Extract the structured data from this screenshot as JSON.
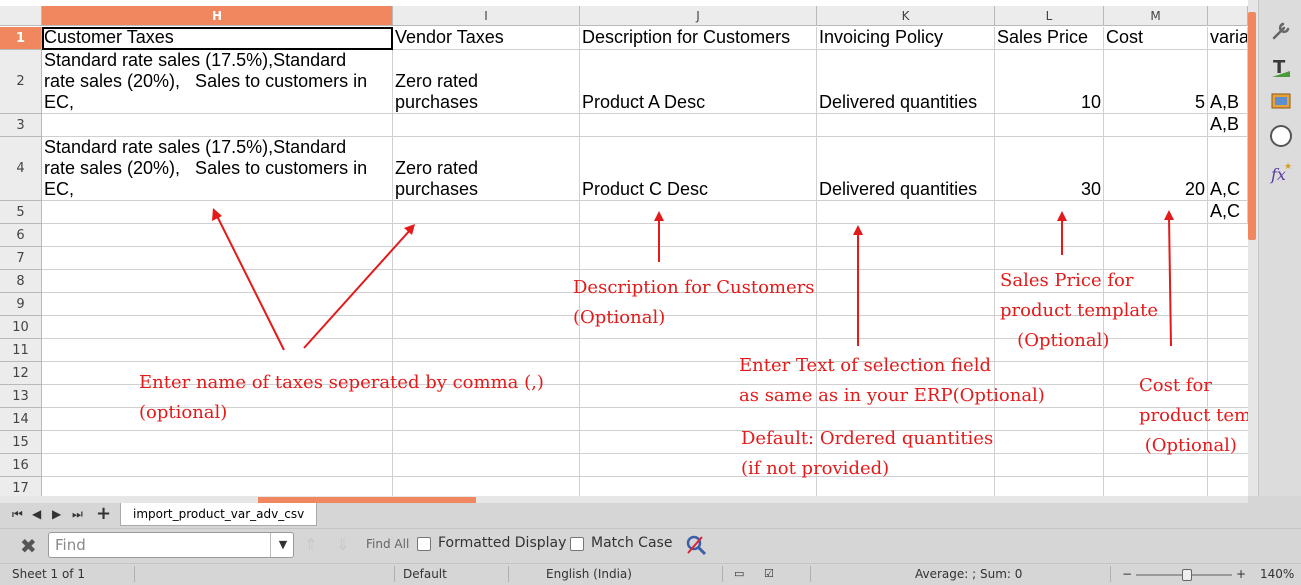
{
  "columns": [
    "H",
    "I",
    "J",
    "K",
    "L",
    "M"
  ],
  "rows": [
    "1",
    "2",
    "3",
    "4",
    "5",
    "6",
    "7",
    "8",
    "9",
    "10",
    "11",
    "12",
    "13",
    "14",
    "15",
    "16",
    "17"
  ],
  "header_row": {
    "h": "Customer Taxes",
    "i": "Vendor Taxes",
    "j": "Description for Customers",
    "k": "Invoicing Policy",
    "l": "Sales Price",
    "m": "Cost",
    "n": "varia"
  },
  "row2": {
    "h": "Standard rate sales (17.5%),Standard\nrate sales (20%),   Sales to customers in\nEC,",
    "i": "Zero rated\npurchases",
    "j": "Product A Desc",
    "k": "Delivered quantities",
    "l": "10",
    "m": "5",
    "n": "A,B"
  },
  "row3": {
    "n": "A,B"
  },
  "row4": {
    "h": "Standard rate sales (17.5%),Standard\nrate sales (20%),   Sales to customers in\nEC,",
    "i": "Zero rated\npurchases",
    "j": "Product C Desc",
    "k": "Delivered quantities",
    "l": "30",
    "m": "20",
    "n": "A,C"
  },
  "row5": {
    "n": "A,C"
  },
  "annotations": {
    "taxes": "Enter name of taxes seperated by comma (,)\n(optional)",
    "description": "Description for Customers\n(Optional)",
    "selection": "Enter Text of selection field\nas same as in your ERP(Optional)",
    "default": "Default: Ordered quantities\n(if not provided)",
    "sales_price": "Sales Price for\nproduct template\n   (Optional)",
    "cost": "Cost for\nproduct template\n (Optional)"
  },
  "sheet_tab": "import_product_var_adv_csv",
  "find": {
    "placeholder": "Find",
    "find_all": "Find All",
    "formatted_display": "Formatted Display",
    "match_case": "Match Case"
  },
  "status": {
    "sheet": "Sheet 1 of 1",
    "style": "Default",
    "language": "English (India)",
    "summary": "Average: ; Sum: 0",
    "zoom": "140%"
  },
  "icons": [
    "properties-icon",
    "styles-icon",
    "gallery-icon",
    "navigator-icon",
    "functions-icon"
  ],
  "colors": {
    "accent": "#f0875f",
    "annotation": "#e41a1a"
  }
}
